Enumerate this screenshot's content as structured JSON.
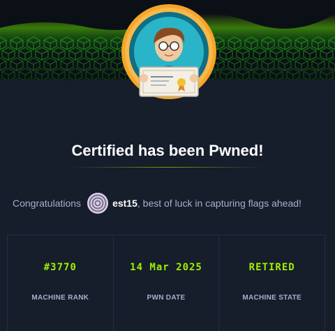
{
  "heading": "Certified has been Pwned!",
  "congrats": {
    "prefix": "Congratulations",
    "username": "est15",
    "suffix": ", best of luck in capturing flags ahead!"
  },
  "stats": [
    {
      "value": "#3770",
      "label": "MACHINE RANK"
    },
    {
      "value": "14 Mar 2025",
      "label": "PWN DATE"
    },
    {
      "value": "RETIRED",
      "label": "MACHINE STATE"
    }
  ],
  "colors": {
    "accent": "#9fef00",
    "background": "#161d2b",
    "badge_ring": "#f6a528",
    "muted_text": "#a4b1cd"
  },
  "icons": {
    "badge": "certificate-avatar-icon",
    "user_avatar": "concentric-circles-avatar-icon"
  }
}
